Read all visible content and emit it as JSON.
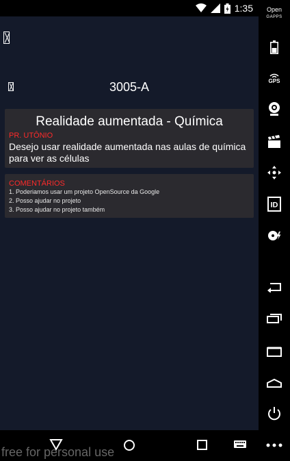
{
  "status_bar": {
    "time": "1:35"
  },
  "room": {
    "title": "3005-A"
  },
  "idea": {
    "title": "Realidade aumentada - Química",
    "author": "PR. UTÔNIO",
    "description": "Desejo usar realidade aumentada nas aulas de química para ver as células"
  },
  "comments": {
    "heading": "COMENTÁRIOS",
    "items": [
      "1. Poderiamos usar um projeto OpenSource da Google",
      "2. Posso ajudar no projeto",
      "3. Posso ajudar no projeto também"
    ]
  },
  "side_panel": {
    "opengapps_line1": "Open",
    "opengapps_line2": "GAPPS",
    "gps_label": "GPS",
    "id_label": "ID"
  },
  "watermark": "free for personal use",
  "colors": {
    "accent_red": "#ff2a2a",
    "card_bg": "#2b2a2f",
    "app_bg": "#141a2a"
  }
}
